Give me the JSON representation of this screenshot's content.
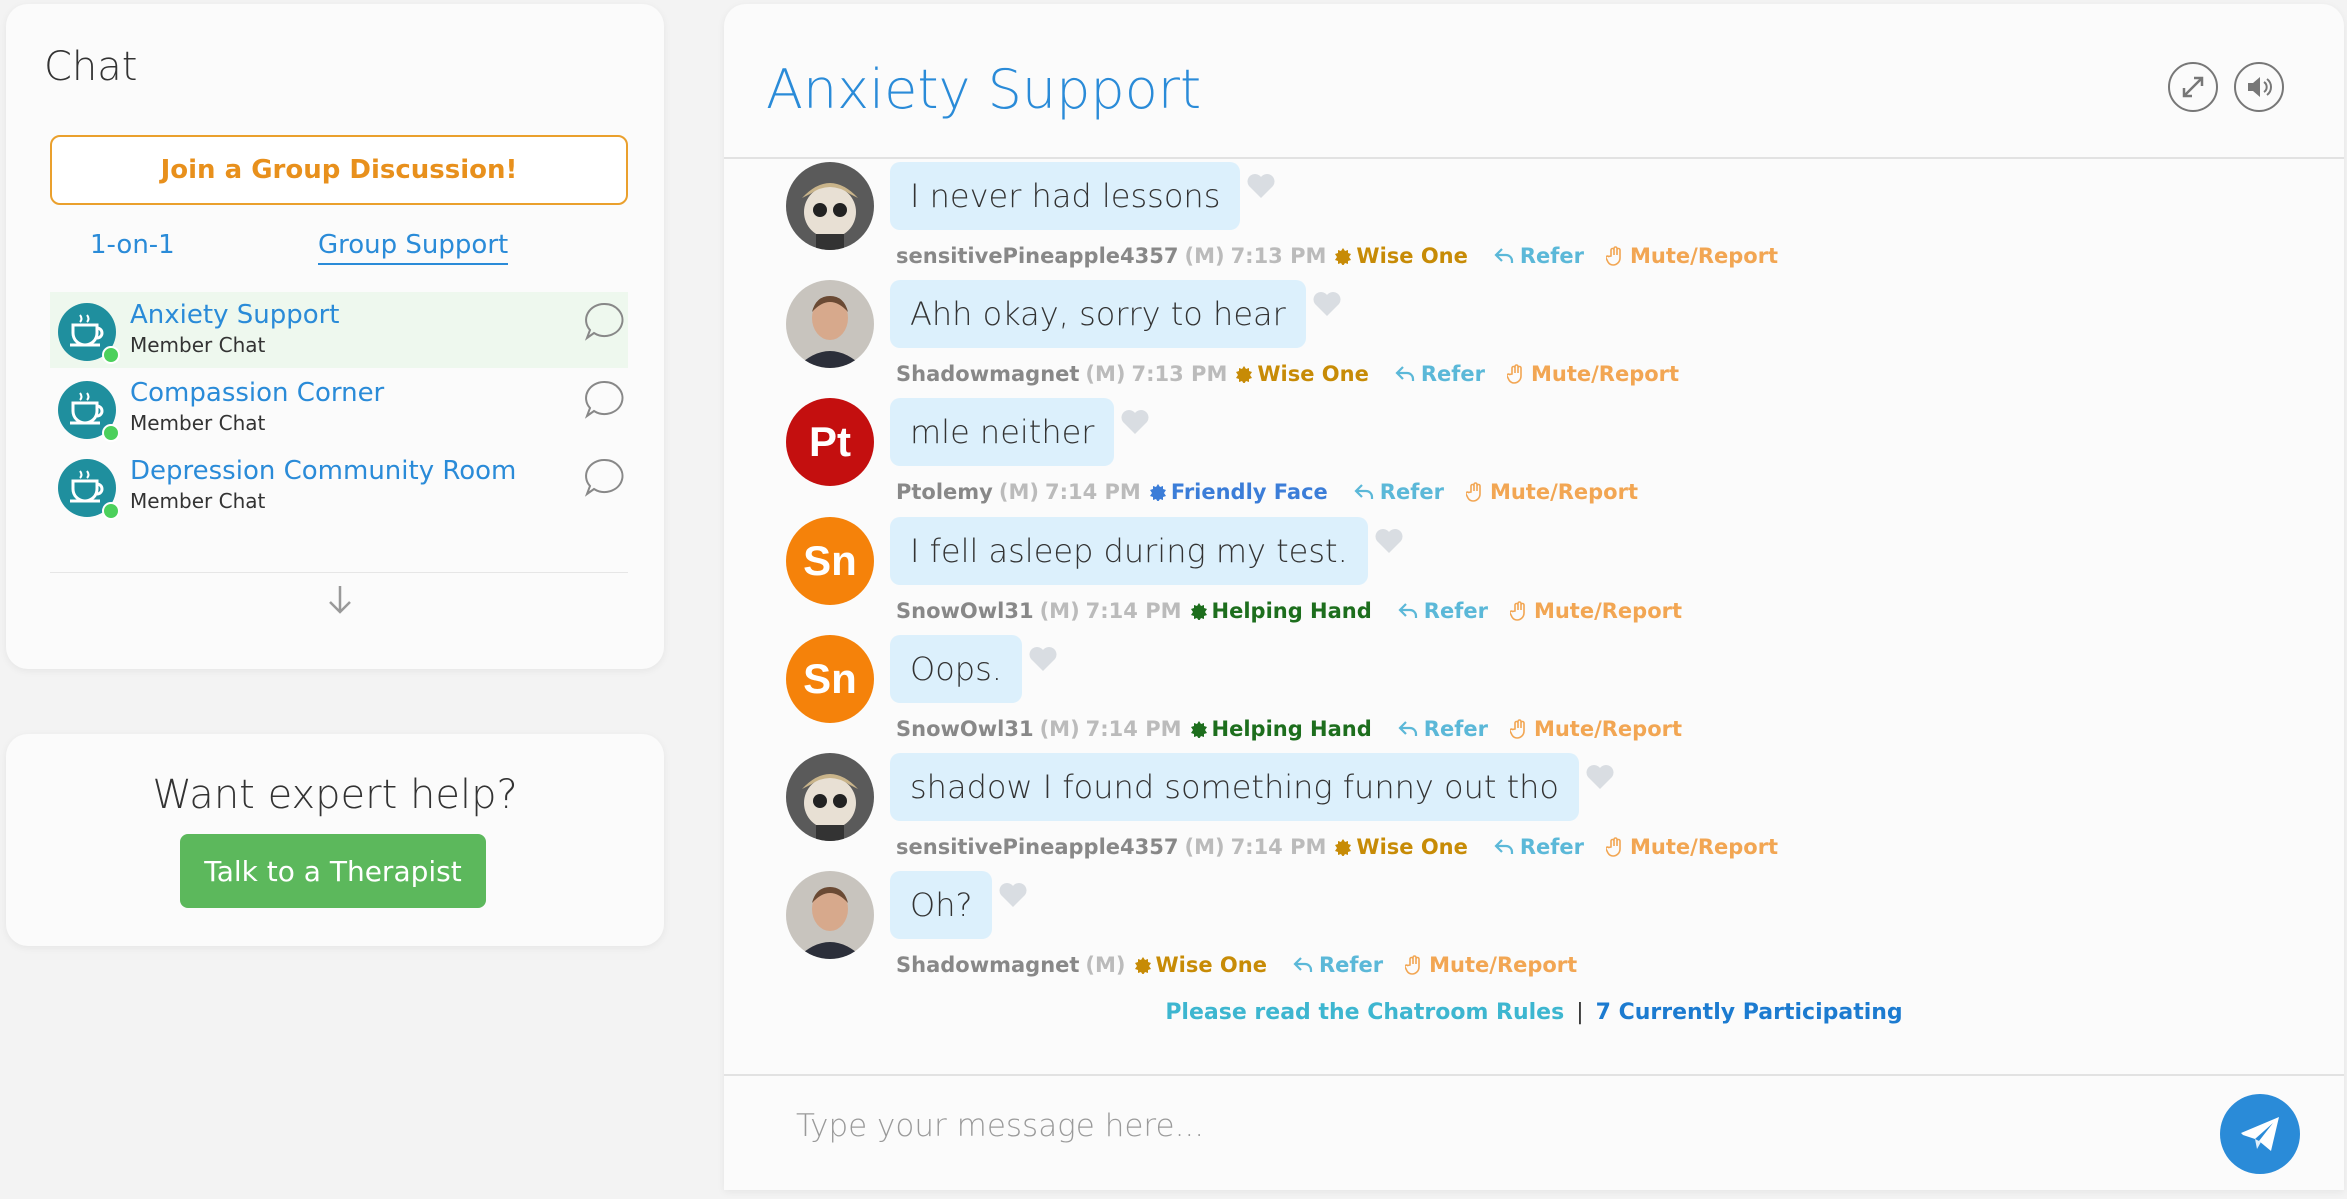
{
  "sidebar": {
    "title": "Chat",
    "join_button": "Join a Group Discussion!",
    "tabs": [
      {
        "label": "1-on-1",
        "active": false
      },
      {
        "label": "Group Support",
        "active": true
      }
    ],
    "rooms": [
      {
        "name": "Anxiety Support",
        "subtitle": "Member Chat",
        "active": true,
        "icon": "teacup-icon"
      },
      {
        "name": "Compassion Corner",
        "subtitle": "Member Chat",
        "active": false,
        "icon": "teacup-icon"
      },
      {
        "name": "Depression Community Room",
        "subtitle": "Member Chat",
        "active": false,
        "icon": "teacup-icon"
      }
    ]
  },
  "expert": {
    "title": "Want expert help?",
    "button": "Talk to a Therapist"
  },
  "chat": {
    "room_title": "Anxiety Support",
    "messages": [
      {
        "text": "I never had lessons",
        "user": "sensitivePineapple4357",
        "gender": "(M)",
        "time": "7:13 PM",
        "badge": "Wise One",
        "refer": "Refer",
        "mute": "Mute/Report",
        "avatar": "photo-cartoon"
      },
      {
        "text": "Ahh okay, sorry to hear",
        "user": "Shadowmagnet",
        "gender": "(M)",
        "time": "7:13 PM",
        "badge": "Wise One",
        "refer": "Refer",
        "mute": "Mute/Report",
        "avatar": "photo-man"
      },
      {
        "text": "mle neither",
        "user": "Ptolemy",
        "gender": "(M)",
        "time": "7:14 PM",
        "badge": "Friendly Face",
        "refer": "Refer",
        "mute": "Mute/Report",
        "avatar": "Pt"
      },
      {
        "text": "I fell asleep during my test.",
        "user": "SnowOwl31",
        "gender": "(M)",
        "time": "7:14 PM",
        "badge": "Helping Hand",
        "refer": "Refer",
        "mute": "Mute/Report",
        "avatar": "Sn"
      },
      {
        "text": "Oops.",
        "user": "SnowOwl31",
        "gender": "(M)",
        "time": "7:14 PM",
        "badge": "Helping Hand",
        "refer": "Refer",
        "mute": "Mute/Report",
        "avatar": "Sn"
      },
      {
        "text": "shadow I found something funny out tho",
        "user": "sensitivePineapple4357",
        "gender": "(M)",
        "time": "7:14 PM",
        "badge": "Wise One",
        "refer": "Refer",
        "mute": "Mute/Report",
        "avatar": "photo-cartoon"
      },
      {
        "text": "Oh?",
        "user": "Shadowmagnet",
        "gender": "(M)",
        "time": "",
        "badge": "Wise One",
        "refer": "Refer",
        "mute": "Mute/Report",
        "avatar": "photo-man"
      }
    ],
    "rules_link": "Please read the Chatroom Rules",
    "separator": "|",
    "participating": "7 Currently Participating",
    "input_placeholder": "Type your message here..."
  },
  "colors": {
    "accent_blue": "#2a8bd8",
    "join_orange": "#e8901c",
    "therapist_green": "#5cb85c",
    "bubble_bg": "#dcf0fc",
    "wise_one": "#c78b06",
    "friendly_face": "#3b7dd8",
    "helping_hand": "#1d6e1d",
    "avatar_pt": "#c40f0f",
    "avatar_sn": "#f5820a"
  }
}
